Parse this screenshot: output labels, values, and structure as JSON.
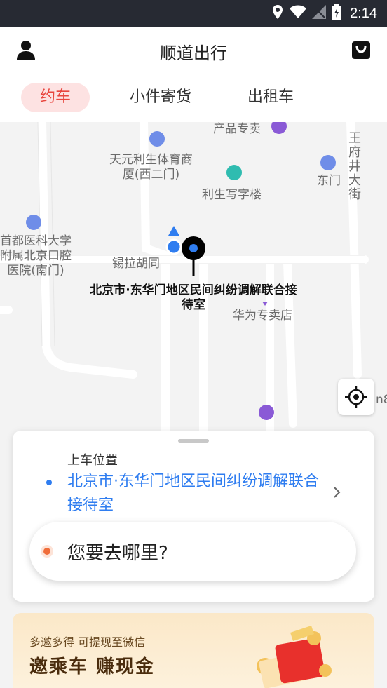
{
  "status_bar": {
    "time": "2:14",
    "icons": [
      "location-icon",
      "wifi-icon",
      "signal-icon",
      "battery-icon"
    ]
  },
  "header": {
    "title": "顺道出行",
    "left_icon": "user-icon",
    "right_icon": "bag-icon"
  },
  "tabs": [
    {
      "label": "约车",
      "active": true
    },
    {
      "label": "小件寄货",
      "active": false
    },
    {
      "label": "出租车",
      "active": false
    }
  ],
  "map": {
    "pois": [
      {
        "label": "产品专卖"
      },
      {
        "label": "天元利生体育商\n厦(西二门)"
      },
      {
        "label": "利生写字楼"
      },
      {
        "label": "东门"
      },
      {
        "label": "王\n府\n井\n大\n街"
      },
      {
        "label": "首都医科大学\n附属北京口腔\n医院(南门)"
      },
      {
        "label": "锡拉胡同"
      },
      {
        "label": "华为专卖店"
      },
      {
        "label": "n8"
      }
    ],
    "pin_label": "北京市·东华门地区民间纠纷调解联合接\n待室"
  },
  "pickup": {
    "label": "上车位置",
    "address": "北京市·东华门地区民间纠纷调解联合接待室"
  },
  "destination": {
    "placeholder": "您要去哪里?"
  },
  "promo": {
    "subtitle": "多邀多得 可提现至微信",
    "title": "邀乘车 赚现金"
  },
  "colors": {
    "accent": "#e8463e",
    "link": "#2f7df0",
    "status_bar": "#272a33"
  }
}
